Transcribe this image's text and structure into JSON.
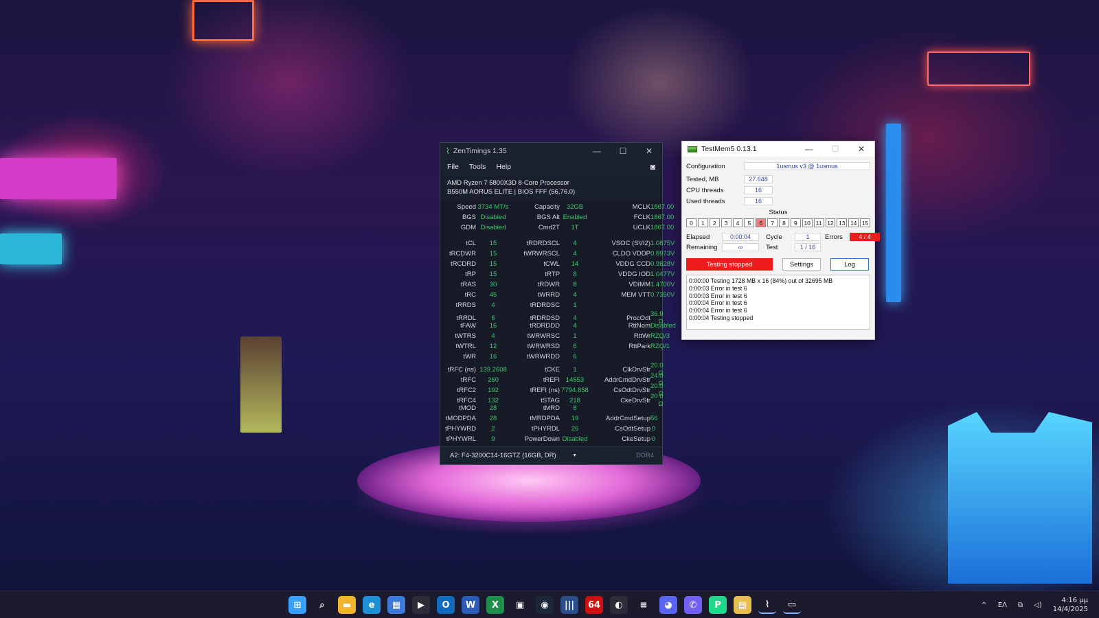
{
  "zentimings": {
    "title": "ZenTimings 1.35",
    "menu": [
      "File",
      "Tools",
      "Help"
    ],
    "cpu": "AMD Ryzen 7 5800X3D 8-Core Processor",
    "board": "B550M AORUS ELITE | BIOS FFF (56.76.0)",
    "top_rows": [
      [
        "Speed",
        "3734 MT/s",
        "Capacity",
        "32GB",
        "MCLK",
        "1867.00"
      ],
      [
        "BGS",
        "Disabled",
        "BGS Alt",
        "Enabled",
        "FCLK",
        "1867.00"
      ],
      [
        "GDM",
        "Disabled",
        "Cmd2T",
        "1T",
        "UCLK",
        "1867.00"
      ]
    ],
    "rows": [
      [
        "tCL",
        "15",
        "tRDRDSCL",
        "4",
        "VSOC (SVI2)",
        "1.0875V"
      ],
      [
        "tRCDWR",
        "15",
        "tWRWRSCL",
        "4",
        "CLDO VDDP",
        "0.8973V"
      ],
      [
        "tRCDRD",
        "15",
        "tCWL",
        "14",
        "VDDG CCD",
        "0.9828V"
      ],
      [
        "tRP",
        "15",
        "tRTP",
        "8",
        "VDDG IOD",
        "1.0477V"
      ],
      [
        "tRAS",
        "30",
        "tRDWR",
        "8",
        "VDIMM",
        "1.4700V"
      ],
      [
        "tRC",
        "45",
        "tWRRD",
        "4",
        "MEM VTT",
        "0.7350V"
      ],
      [
        "tRRDS",
        "4",
        "tRDRDSC",
        "1",
        "",
        ""
      ],
      [
        "tRRDL",
        "6",
        "tRDRDSD",
        "4",
        "ProcOdt",
        "36.9 Ω"
      ],
      [
        "tFAW",
        "16",
        "tRDRDDD",
        "4",
        "RttNom",
        "Disabled"
      ],
      [
        "tWTRS",
        "4",
        "tWRWRSC",
        "1",
        "RttWr",
        "RZQ/3"
      ],
      [
        "tWTRL",
        "12",
        "tWRWRSD",
        "6",
        "RttPark",
        "RZQ/1"
      ],
      [
        "tWR",
        "16",
        "tWRWRDD",
        "6",
        "",
        ""
      ],
      [
        "tRFC (ns)",
        "139.2608",
        "tCKE",
        "1",
        "ClkDrvStr",
        "20.0 Ω"
      ],
      [
        "tRFC",
        "260",
        "tREFI",
        "14553",
        "AddrCmdDrvStr",
        "24.0 Ω"
      ],
      [
        "tRFC2",
        "192",
        "tREFI (ns)",
        "7794.858",
        "CsOdtDrvStr",
        "20.0 Ω"
      ],
      [
        "tRFC4",
        "132",
        "tSTAG",
        "218",
        "CkeDrvStr",
        "20.0 Ω"
      ],
      [
        "tMOD",
        "28",
        "tMRD",
        "8",
        "",
        ""
      ],
      [
        "tMODPDA",
        "28",
        "tMRDPDA",
        "19",
        "AddrCmdSetup",
        "56"
      ],
      [
        "tPHYWRD",
        "2",
        "tPHYRDL",
        "26",
        "CsOdtSetup",
        "0"
      ],
      [
        "tPHYWRL",
        "9",
        "PowerDown",
        "Disabled",
        "CkeSetup",
        "0"
      ]
    ],
    "module": "A2: F4-3200C14-16GTZ (16GB, DR)",
    "mem_type": "DDR4"
  },
  "testmem": {
    "title": "TestMem5  0.13.1",
    "config_label": "Configuration",
    "config_value": "1usmus v3 @ 1usmus",
    "tested_label": "Tested, MB",
    "tested_value": "27.648",
    "cpu_threads_label": "CPU threads",
    "cpu_threads_value": "16",
    "used_threads_label": "Used threads",
    "used_threads_value": "16",
    "status_label": "Status",
    "status_cells": [
      "0",
      "1",
      "2",
      "3",
      "4",
      "5",
      "6",
      "7",
      "8",
      "9",
      "10",
      "11",
      "12",
      "13",
      "14",
      "15"
    ],
    "error_cell": "6",
    "elapsed_label": "Elapsed",
    "elapsed_value": "0:00:04",
    "cycle_label": "Cycle",
    "cycle_value": "1",
    "errors_label": "Errors",
    "errors_value": "4 / 4",
    "remaining_label": "Remaining",
    "remaining_value": "∞",
    "test_label": "Test",
    "test_value": "1 / 16",
    "stop_button": "Testing stopped",
    "settings_button": "Settings",
    "log_button": "Log",
    "log_lines": [
      "0:00:00  Testing 1728 MB x 16 (84%) out of 32695 MB",
      "0:00:03  Error in test 6",
      "0:00:03  Error in test 6",
      "0:00:04  Error in test 6",
      "0:00:04  Error in test 6",
      "0:00:04  Testing stopped"
    ]
  },
  "taskbar": {
    "apps": [
      {
        "name": "start-button",
        "glyph": "⊞",
        "color": "#3aa0ff"
      },
      {
        "name": "search-icon",
        "glyph": "⌕",
        "color": "#1c1b2e"
      },
      {
        "name": "file-explorer-icon",
        "glyph": "▬",
        "color": "#f0b530"
      },
      {
        "name": "edge-icon",
        "glyph": "e",
        "color": "#1f8fd6"
      },
      {
        "name": "store-icon",
        "glyph": "▦",
        "color": "#3b7ad8"
      },
      {
        "name": "media-player-icon",
        "glyph": "▶",
        "color": "#2d2d3a"
      },
      {
        "name": "outlook-icon",
        "glyph": "O",
        "color": "#0f6cbd"
      },
      {
        "name": "word-icon",
        "glyph": "W",
        "color": "#2b5cb8"
      },
      {
        "name": "excel-icon",
        "glyph": "X",
        "color": "#1d8f4a"
      },
      {
        "name": "nvidia-icon",
        "glyph": "▣",
        "color": "#1c1b2e"
      },
      {
        "name": "steam-icon",
        "glyph": "◉",
        "color": "#1b2838"
      },
      {
        "name": "equalizer-icon",
        "glyph": "|||",
        "color": "#2a4f8a"
      },
      {
        "name": "aida64-icon",
        "glyph": "64",
        "color": "#d01010"
      },
      {
        "name": "hardware-monitor-icon",
        "glyph": "◐",
        "color": "#2d2d3a"
      },
      {
        "name": "tool-icon",
        "glyph": "≡",
        "color": "#1c1b2e"
      },
      {
        "name": "discord-icon",
        "glyph": "◕",
        "color": "#5865f2"
      },
      {
        "name": "viber-icon",
        "glyph": "✆",
        "color": "#7360f2"
      },
      {
        "name": "pycharm-icon",
        "glyph": "P",
        "color": "#21d789"
      },
      {
        "name": "notes-icon",
        "glyph": "▤",
        "color": "#e8c050"
      },
      {
        "name": "zentimings-taskbar-icon",
        "glyph": "⌇",
        "color": "#1c1b2e"
      },
      {
        "name": "testmem-taskbar-icon",
        "glyph": "▭",
        "color": "#1c1b2e"
      }
    ],
    "tray_chevron": "^",
    "language": "ΕΛ",
    "time": "4:16 μμ",
    "date": "14/4/2025"
  }
}
